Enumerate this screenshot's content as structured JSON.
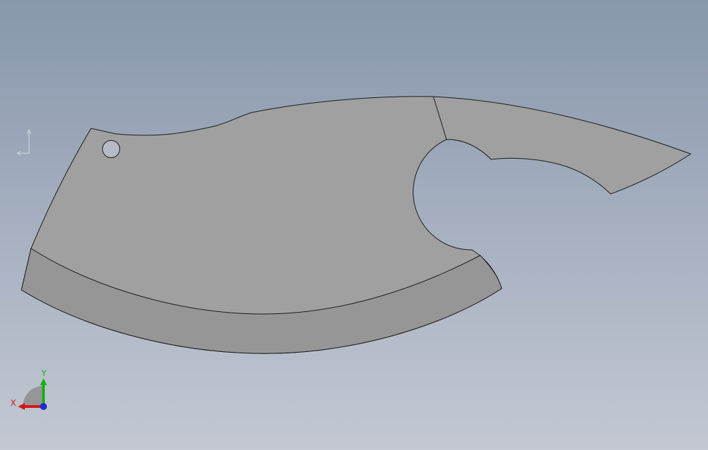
{
  "viewport": {
    "background_top": "#8897ac",
    "background_bottom": "#c3c8d3"
  },
  "model": {
    "part": "cleaver blade",
    "blade_color": "#a0a0a0",
    "edge_band_color": "#969696",
    "outline_color": "#1a1a1a"
  },
  "triad": {
    "x_label": "X",
    "y_label": "Y",
    "x_color": "#d01818",
    "y_color": "#18b018",
    "z_color": "#1c2ed0"
  },
  "origin_marker": {
    "icon": "origin-axis-icon"
  }
}
